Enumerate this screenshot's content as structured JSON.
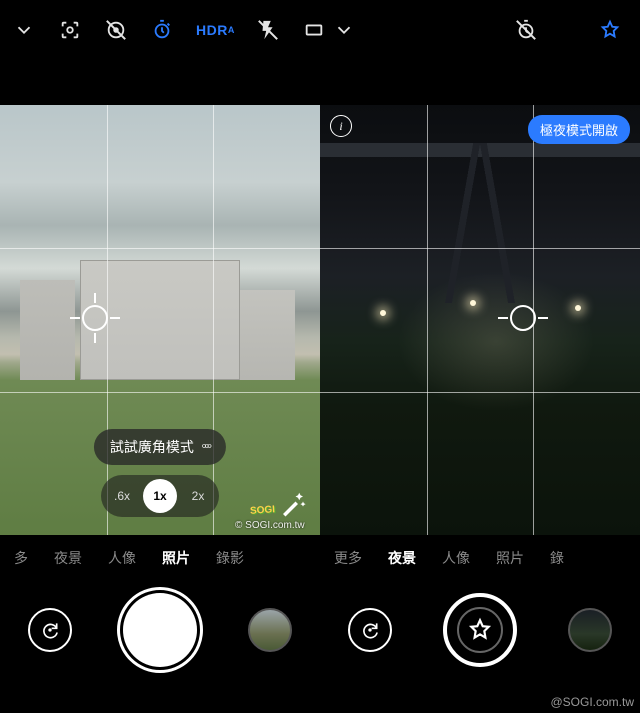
{
  "watermark_center": "© SOGI.com.tw",
  "watermark_corner": "@SOGI.com.tw",
  "sogi_stamp": "SOGI",
  "left": {
    "top_icons": {
      "settings_chevron": "settings",
      "lens": "lens",
      "motion_off": "motion-off",
      "timer": "timer",
      "hdr_label": "HDR",
      "hdr_sub": "A",
      "flash_off": "flash-off",
      "aspect": "aspect"
    },
    "suggestion_text": "試試廣角模式",
    "suggestion_icon": "৹৹৹",
    "zoom": {
      "a": ".6x",
      "b": "1x",
      "c": "2x",
      "active": "1x"
    },
    "modes": [
      "多",
      "夜景",
      "人像",
      "照片",
      "錄影"
    ],
    "active_mode": "照片"
  },
  "right": {
    "top_icons": {
      "settings_chevron": "settings",
      "timer_off": "timer-off",
      "favorite": "favorite"
    },
    "info": "i",
    "night_badge": "極夜模式開啟",
    "modes": [
      "更多",
      "夜景",
      "人像",
      "照片",
      "錄"
    ],
    "active_mode": "夜景"
  }
}
